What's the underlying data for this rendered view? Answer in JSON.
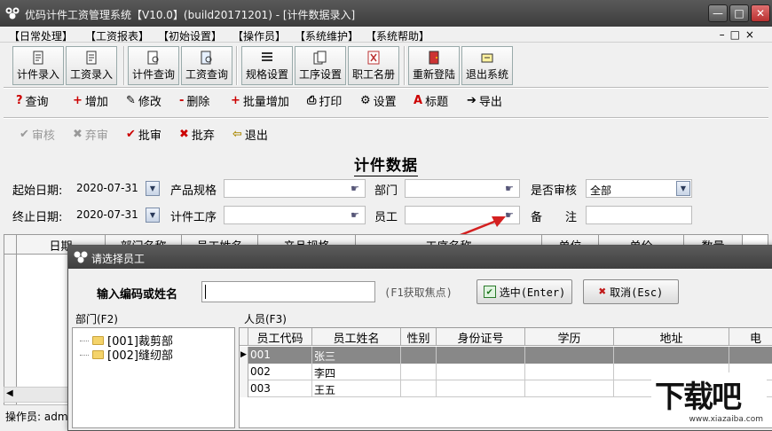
{
  "window": {
    "title": "优码计件工资管理系统【V10.0】(build20171201) - [计件数据录入]",
    "minimize": "—",
    "maximize": "□",
    "close": "✕"
  },
  "menubar": {
    "items": [
      "【日常处理】",
      "【工资报表】",
      "【初始设置】",
      "【操作员】",
      "【系统维护】",
      "【系统帮助】"
    ],
    "mdi_controls": "–□×"
  },
  "big_toolbar": {
    "buttons": [
      "计件录入",
      "工资录入",
      "计件查询",
      "工资查询",
      "规格设置",
      "工序设置",
      "职工名册",
      "重新登陆",
      "退出系统"
    ]
  },
  "toolbar2": {
    "items": [
      {
        "label": "查询",
        "icon": "?"
      },
      {
        "label": "增加",
        "icon": "+"
      },
      {
        "label": "修改",
        "icon": "✎"
      },
      {
        "label": "删除",
        "icon": "-"
      },
      {
        "label": "批量增加",
        "icon": "+"
      },
      {
        "label": "打印",
        "icon": "⎙"
      },
      {
        "label": "设置",
        "icon": "⚙"
      },
      {
        "label": "标题",
        "icon": "A"
      },
      {
        "label": "导出",
        "icon": "➔"
      }
    ]
  },
  "toolbar3": {
    "items": [
      {
        "label": "审核",
        "icon": "✔",
        "enabled": false
      },
      {
        "label": "弃审",
        "icon": "✖",
        "enabled": false
      },
      {
        "label": "批审",
        "icon": "✔",
        "enabled": true
      },
      {
        "label": "批弃",
        "icon": "✖",
        "enabled": true
      },
      {
        "label": "退出",
        "icon": "⇦",
        "enabled": true
      }
    ]
  },
  "form": {
    "title": "计件数据",
    "start_date_label": "起始日期:",
    "start_date": "2020-07-31",
    "end_date_label": "终止日期:",
    "end_date": "2020-07-31",
    "product_spec_label": "产品规格",
    "process_label": "计件工序",
    "dept_label": "部门",
    "employee_label": "员工",
    "audited_label": "是否审核",
    "audited_value": "全部",
    "remark_label": "备　　注"
  },
  "grid": {
    "headers": [
      "日期",
      "部门名称",
      "员工姓名",
      "产品规格",
      "工序名称",
      "单位",
      "单价",
      "数量"
    ]
  },
  "status": {
    "operator": "操作员: admin"
  },
  "dialog": {
    "title": "请选择员工",
    "input_label": "输入编码或姓名",
    "input_value": "",
    "hint": "(F1获取焦点)",
    "ok_label": "选中(Enter)",
    "cancel_label": "取消(Esc)",
    "dept_section": "部门(F2)",
    "people_section": "人员(F3)",
    "departments": [
      "[001]裁剪部",
      "[002]缝纫部"
    ],
    "columns": [
      "员工代码",
      "员工姓名",
      "性别",
      "身份证号",
      "学历",
      "地址",
      "电"
    ],
    "rows": [
      {
        "code": "001",
        "name": "张三"
      },
      {
        "code": "002",
        "name": "李四"
      },
      {
        "code": "003",
        "name": "王五"
      }
    ],
    "selected_row": 0
  },
  "watermark": {
    "text": "下载吧",
    "url": "www.xiazaiba.com"
  },
  "colors": {
    "titlebar": "#4a4a4a",
    "selected_row": "#888888",
    "annotation_arrow": "#d42020"
  }
}
